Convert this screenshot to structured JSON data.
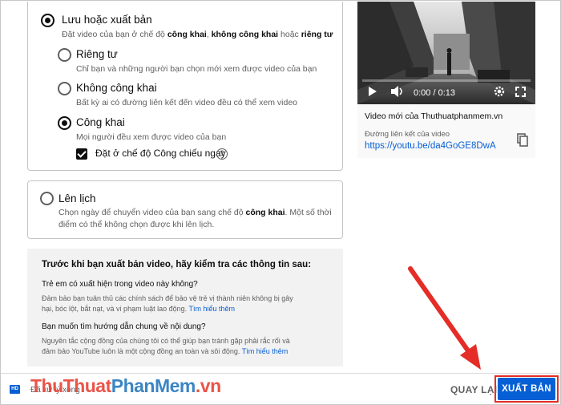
{
  "visibility": {
    "save_or_publish": {
      "title": "Lưu hoặc xuất bản",
      "desc_pre": "Đặt video của bạn ở chế độ ",
      "desc_b1": "công khai",
      "desc_sep": ", ",
      "desc_b2": "không công khai",
      "desc_mid": " hoặc ",
      "desc_b3": "riêng tư",
      "selected": true
    },
    "options": {
      "private": {
        "title": "Riêng tư",
        "desc": "Chỉ bạn và những người bạn chọn mới xem được video của bạn",
        "selected": false
      },
      "unlisted": {
        "title": "Không công khai",
        "desc": "Bất kỳ ai có đường liên kết đến video đều có thể xem video",
        "selected": false
      },
      "public": {
        "title": "Công khai",
        "desc": "Mọi người đều xem được video của bạn",
        "selected": true
      }
    },
    "premiere_checkbox": {
      "label": "Đặt ở chế độ Công chiếu ngay",
      "checked": true,
      "help_icon": "?"
    }
  },
  "schedule": {
    "title": "Lên lịch",
    "desc_line1_pre": "Chọn ngày để chuyển video của bạn sang chế độ ",
    "desc_line1_b": "công khai",
    "desc_line1_post": ". Một số thời",
    "desc_line2": "điểm có thể không chọn được khi lên lịch.",
    "selected": false
  },
  "checklist": {
    "title": "Trước khi bạn xuất bản video, hãy kiểm tra các thông tin sau:",
    "q1": "Trẻ em có xuất hiện trong video này không?",
    "a1_line1": "Đảm bảo bạn tuân thủ các chính sách để bảo vệ trẻ vị thành niên không bị gây",
    "a1_line2": "hại, bóc lột, bắt nạt, và vi phạm luật lao động. ",
    "a1_link": "Tìm hiểu thêm",
    "q2": "Bạn muốn tìm hướng dẫn chung về nội dung?",
    "a2_line1": "Nguyên tắc cộng đồng của chúng tôi có thể giúp bạn tránh gặp phải rắc rối và",
    "a2_line2": "đảm bảo YouTube luôn là một cộng đồng an toàn và sôi động. ",
    "a2_link": "Tìm hiểu thêm"
  },
  "video": {
    "time": "0:00 / 0:13",
    "progress": 0,
    "title": "Video mới của Thuthuatphanmem.vn",
    "link_label": "Đường liên kết của video",
    "link_url": "https://youtu.be/da4GoGE8DwA"
  },
  "footer": {
    "hd_badge": "HD",
    "status": "Đã xử lý xong",
    "watermark_a": "ThuThuat",
    "watermark_b": "PhanMem",
    "watermark_c": ".vn",
    "back_label": "QUAY LẠI",
    "publish_label": "XUẤT BẢN"
  },
  "colors": {
    "accent": "#065fd4",
    "annotation_red": "#e52d27",
    "selected_radio": "#0d0d0d"
  }
}
